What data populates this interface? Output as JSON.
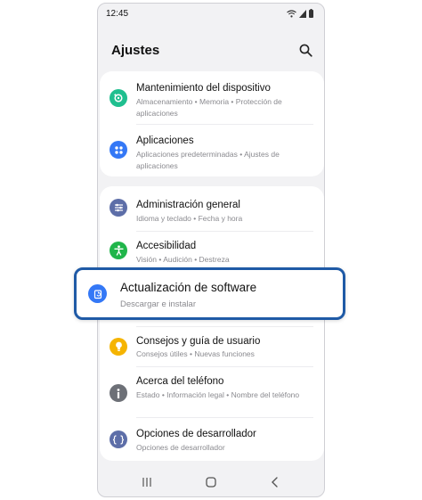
{
  "status": {
    "time": "12:45"
  },
  "header": {
    "title": "Ajustes"
  },
  "items": [
    {
      "title": "Mantenimiento del dispositivo",
      "subtitle": "Almacenamiento  •  Memoria  •  Protección de aplicaciones",
      "icon": "device-care-icon",
      "color": "#1fbf8f"
    },
    {
      "title": "Aplicaciones",
      "subtitle": "Aplicaciones predeterminadas  •  Ajustes de aplicaciones",
      "icon": "apps-icon",
      "color": "#3478f6"
    },
    {
      "title": "Administración general",
      "subtitle": "Idioma y teclado  •  Fecha y hora",
      "icon": "sliders-icon",
      "color": "#5d6ea8"
    },
    {
      "title": "Accesibilidad",
      "subtitle": "Visión  •  Audición  •  Destreza",
      "icon": "accessibility-icon",
      "color": "#20b54a"
    },
    {
      "title": "Actualización de software",
      "subtitle": "Descargar e instalar",
      "icon": "software-update-icon",
      "color": "#3478f6"
    },
    {
      "title": "Consejos y guía de usuario",
      "subtitle": "Consejos útiles  •  Nuevas funciones",
      "icon": "lightbulb-icon",
      "color": "#f5b400"
    },
    {
      "title": "Acerca del teléfono",
      "subtitle": "Estado  •  Información legal  •  Nombre del teléfono",
      "icon": "info-icon",
      "color": "#6d7077"
    },
    {
      "title": "Opciones de desarrollador",
      "subtitle": "Opciones de desarrollador",
      "icon": "developer-icon",
      "color": "#5d6ea8"
    }
  ],
  "colors": {
    "highlight_border": "#1f5aa6",
    "background": "#f2f2f4"
  }
}
